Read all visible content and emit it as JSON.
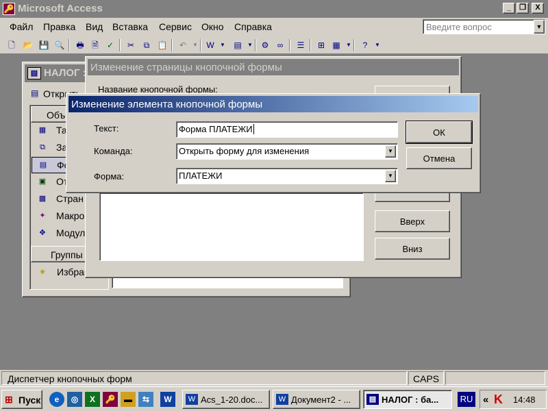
{
  "app": {
    "title": "Microsoft Access",
    "caption_buttons": {
      "minimize": "_",
      "restore": "❐",
      "close": "X"
    }
  },
  "menu": {
    "items": [
      {
        "label": "Файл"
      },
      {
        "label": "Правка"
      },
      {
        "label": "Вид"
      },
      {
        "label": "Вставка"
      },
      {
        "label": "Сервис"
      },
      {
        "label": "Окно"
      },
      {
        "label": "Справка"
      }
    ],
    "help_placeholder": "Введите вопрос"
  },
  "toolbar": {
    "icons": [
      "new-icon",
      "open-icon",
      "save-icon",
      "search-icon",
      "print-icon",
      "print-preview-icon",
      "spelling-icon",
      "cut-icon",
      "copy-icon",
      "paste-icon",
      "undo-icon",
      "office-links-icon",
      "analyze-icon",
      "code-icon",
      "script-icon",
      "properties-icon",
      "relationships-icon",
      "new-object-icon",
      "help-icon"
    ]
  },
  "db_window": {
    "title": "НАЛОГ :",
    "open_button": "Открыть",
    "objects_header": "Объе",
    "objects": [
      {
        "label": "Та",
        "icon": "table-icon"
      },
      {
        "label": "За",
        "icon": "query-icon"
      },
      {
        "label": "Фо",
        "icon": "form-icon"
      },
      {
        "label": "От",
        "icon": "report-icon"
      },
      {
        "label": "Стран",
        "icon": "page-icon"
      },
      {
        "label": "Макро",
        "icon": "macro-icon"
      },
      {
        "label": "Модул",
        "icon": "module-icon"
      }
    ],
    "groups_header": "Группы",
    "favorites": "Избран"
  },
  "page_dialog": {
    "title": "Изменение страницы кнопочной формы",
    "name_label": "Название кнопочной формы:",
    "buttons": {
      "up": "Вверх",
      "down": "Вниз"
    }
  },
  "item_dialog": {
    "title": "Изменение элемента кнопочной формы",
    "text_label": "Текст:",
    "text_value": "Форма ПЛАТЕЖИ",
    "command_label": "Команда:",
    "command_value": "Открыть форму для изменения",
    "form_label": "Форма:",
    "form_value": "ПЛАТЕЖИ",
    "ok": "ОК",
    "cancel": "Отмена"
  },
  "status": {
    "text": "Диспетчер кнопочных форм",
    "caps": "CAPS"
  },
  "taskbar": {
    "start": "Пуск",
    "tasks": [
      {
        "label": "Acs_1-20.doc...",
        "icon": "word-doc-icon"
      },
      {
        "label": "Документ2 - ...",
        "icon": "word-doc-icon"
      },
      {
        "label": "НАЛОГ : ба...",
        "icon": "access-db-icon"
      }
    ],
    "lang": "RU",
    "chevron": "«",
    "time": "14:48"
  },
  "colors": {
    "active_title_start": "#0a246a",
    "active_title_end": "#a6caf0",
    "inactive_title": "#808080",
    "face": "#d4d0c8",
    "mdi_background": "#808080"
  }
}
